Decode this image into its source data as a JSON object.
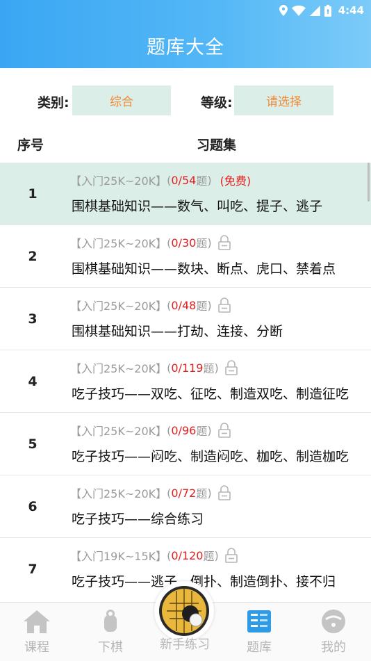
{
  "status_bar": {
    "time": "4:44",
    "icons": [
      "location-icon",
      "wifi-icon",
      "signal-icon",
      "battery-icon"
    ]
  },
  "header": {
    "title": "题库大全"
  },
  "filters": {
    "category_label": "类别:",
    "category_value": "综合",
    "level_label": "等级:",
    "level_value": "请选择"
  },
  "columns": {
    "index": "序号",
    "set": "习题集"
  },
  "rows": [
    {
      "index": "1",
      "level": "【入门25K~20K】",
      "count_open": "(",
      "count": "0/54",
      "count_unit": "题",
      "count_close": ")",
      "free": "(免费)",
      "locked": false,
      "name": "围棋基础知识——数气、叫吃、提子、逃子"
    },
    {
      "index": "2",
      "level": "【入门25K~20K】",
      "count_open": "(",
      "count": "0/30",
      "count_unit": "题",
      "count_close": ")",
      "free": "",
      "locked": true,
      "name": "围棋基础知识——数块、断点、虎口、禁着点"
    },
    {
      "index": "3",
      "level": "【入门25K~20K】",
      "count_open": "(",
      "count": "0/48",
      "count_unit": "题",
      "count_close": ")",
      "free": "",
      "locked": true,
      "name": "围棋基础知识——打劫、连接、分断"
    },
    {
      "index": "4",
      "level": "【入门25K~20K】",
      "count_open": "(",
      "count": "0/119",
      "count_unit": "题",
      "count_close": ")",
      "free": "",
      "locked": true,
      "name": "吃子技巧——双吃、征吃、制造双吃、制造征吃"
    },
    {
      "index": "5",
      "level": "【入门25K~20K】",
      "count_open": "(",
      "count": "0/96",
      "count_unit": "题",
      "count_close": ")",
      "free": "",
      "locked": true,
      "name": "吃子技巧——闷吃、制造闷吃、枷吃、制造枷吃"
    },
    {
      "index": "6",
      "level": "【入门25K~20K】",
      "count_open": "(",
      "count": "0/72",
      "count_unit": "题",
      "count_close": ")",
      "free": "",
      "locked": true,
      "name": "吃子技巧——综合练习"
    },
    {
      "index": "7",
      "level": "【入门19K~15K】",
      "count_open": "(",
      "count": "0/120",
      "count_unit": "题",
      "count_close": ")",
      "free": "",
      "locked": true,
      "name": "吃子技巧——逃子、倒扑、制造倒扑、接不归"
    }
  ],
  "tabbar": {
    "tabs": [
      {
        "label": "课程",
        "icon": "house-icon"
      },
      {
        "label": "下棋",
        "icon": "hand-icon"
      },
      {
        "label": "新手练习",
        "icon": "go-board-icon"
      },
      {
        "label": "题库",
        "icon": "question-bank-icon"
      },
      {
        "label": "我的",
        "icon": "profile-icon"
      }
    ],
    "active_index": 3
  },
  "colors": {
    "header_start": "#3aa6f3",
    "header_end": "#7ccbf8",
    "accent_orange": "#f08a3a",
    "highlight_row": "#dbeee7",
    "count_red": "#e02020"
  }
}
